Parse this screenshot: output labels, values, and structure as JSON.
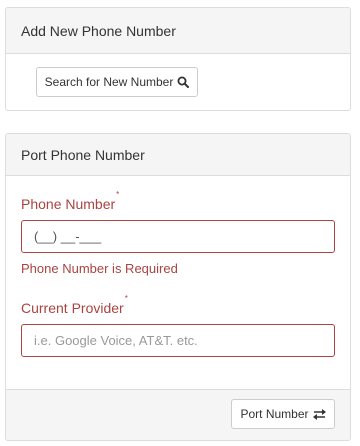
{
  "add_panel": {
    "title": "Add New Phone Number",
    "search_button_label": "Search for New Number"
  },
  "port_panel": {
    "title": "Port Phone Number",
    "phone_field": {
      "label": "Phone Number",
      "required_mark": "*",
      "value": "(__) __-___",
      "error": "Phone Number is Required"
    },
    "provider_field": {
      "label": "Current Provider",
      "required_mark": "*",
      "placeholder": "i.e. Google Voice, AT&T. etc."
    },
    "port_button_label": "Port Number"
  },
  "colors": {
    "error": "#a94442",
    "panel_heading_bg": "#f5f5f5",
    "border": "#dddddd"
  },
  "icons": {
    "search_button": "search-icon",
    "port_button": "transfer-arrows-icon"
  }
}
